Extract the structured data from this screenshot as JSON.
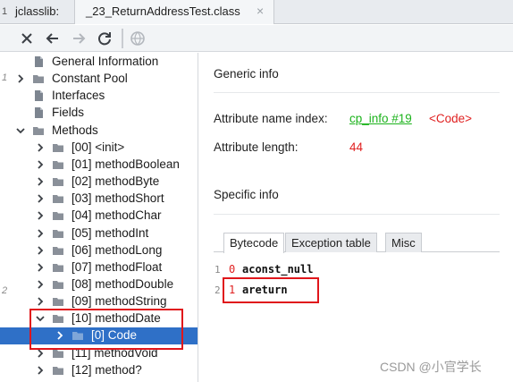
{
  "tabbar": {
    "gutter_num": "1",
    "app_label": "jclasslib:",
    "file_tab": "_23_ReturnAddressTest.class",
    "close_glyph": "×"
  },
  "toolbar": {
    "buttons": [
      "close-icon",
      "back-icon",
      "forward-icon",
      "refresh-icon",
      "web-icon"
    ]
  },
  "tree": {
    "gutter_nums": [
      "1",
      "2"
    ],
    "items": [
      {
        "label": "General Information",
        "icon": "file-icon"
      },
      {
        "label": "Constant Pool",
        "icon": "folder-icon"
      },
      {
        "label": "Interfaces",
        "icon": "file-icon"
      },
      {
        "label": "Fields",
        "icon": "file-icon"
      },
      {
        "label": "Methods",
        "icon": "folder-icon"
      },
      {
        "label": "[00] <init>",
        "icon": "folder-icon"
      },
      {
        "label": "[01] methodBoolean",
        "icon": "folder-icon"
      },
      {
        "label": "[02] methodByte",
        "icon": "folder-icon"
      },
      {
        "label": "[03] methodShort",
        "icon": "folder-icon"
      },
      {
        "label": "[04] methodChar",
        "icon": "folder-icon"
      },
      {
        "label": "[05] methodInt",
        "icon": "folder-icon"
      },
      {
        "label": "[06] methodLong",
        "icon": "folder-icon"
      },
      {
        "label": "[07] methodFloat",
        "icon": "folder-icon"
      },
      {
        "label": "[08] methodDouble",
        "icon": "folder-icon"
      },
      {
        "label": "[09] methodString",
        "icon": "folder-icon"
      },
      {
        "label": "[10] methodDate",
        "icon": "folder-icon"
      },
      {
        "label": "[0] Code",
        "icon": "folder-icon"
      },
      {
        "label": "[11] methodVoid",
        "icon": "folder-icon"
      },
      {
        "label": "[12] method?",
        "icon": "folder-icon"
      }
    ]
  },
  "detail": {
    "generic_title": "Generic info",
    "attr_name_label": "Attribute name index:",
    "attr_name_link": "cp_info #19",
    "attr_name_value": "<Code>",
    "attr_len_label": "Attribute length:",
    "attr_len_value": "44",
    "specific_title": "Specific info",
    "tabs": [
      "Bytecode",
      "Exception table",
      "Misc"
    ],
    "active_tab": "Bytecode",
    "bytecode": [
      {
        "line": "1",
        "offset": "0",
        "op": "aconst_null"
      },
      {
        "line": "2",
        "offset": "1",
        "op": "areturn"
      }
    ]
  },
  "watermark": "CSDN @小官学长",
  "colors": {
    "selected_row": "#2f70c7",
    "highlight_box": "#e0161b",
    "link": "#1cb31c",
    "value": "#e02020"
  }
}
